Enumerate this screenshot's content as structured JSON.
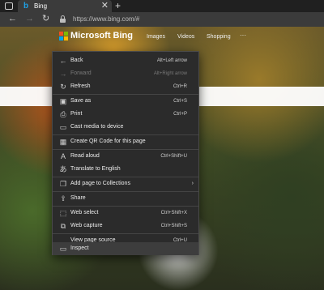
{
  "browser": {
    "tab": {
      "title": "Bing",
      "favicon": "b",
      "close": "✕"
    },
    "new_tab": "+",
    "nav": {
      "back": "←",
      "forward": "→",
      "refresh": "↻"
    },
    "address": {
      "url": "https://www.bing.com/#"
    }
  },
  "page": {
    "logo_text": "Microsoft Bing",
    "nav_items": [
      "Images",
      "Videos",
      "Shopping"
    ],
    "more": "···"
  },
  "context_menu": {
    "items": [
      {
        "icon": "back-arrow-icon",
        "glyph": "←",
        "label": "Back",
        "shortcut": "Alt+Left arrow",
        "enabled": true
      },
      {
        "icon": "forward-arrow-icon",
        "glyph": "→",
        "label": "Forward",
        "shortcut": "Alt+Right arrow",
        "enabled": false
      },
      {
        "icon": "refresh-icon",
        "glyph": "↻",
        "label": "Refresh",
        "shortcut": "Ctrl+R",
        "enabled": true
      },
      {
        "icon": "save-icon",
        "glyph": "▣",
        "label": "Save as",
        "shortcut": "Ctrl+S",
        "enabled": true
      },
      {
        "icon": "print-icon",
        "glyph": "⎙",
        "label": "Print",
        "shortcut": "Ctrl+P",
        "enabled": true
      },
      {
        "icon": "cast-icon",
        "glyph": "▭",
        "label": "Cast media to device",
        "shortcut": "",
        "enabled": true
      },
      {
        "icon": "qr-code-icon",
        "glyph": "▦",
        "label": "Create QR Code for this page",
        "shortcut": "",
        "enabled": true
      },
      {
        "icon": "read-aloud-icon",
        "glyph": "A",
        "label": "Read aloud",
        "shortcut": "Ctrl+Shift+U",
        "enabled": true
      },
      {
        "icon": "translate-icon",
        "glyph": "あ",
        "label": "Translate to English",
        "shortcut": "",
        "enabled": true
      },
      {
        "icon": "collections-icon",
        "glyph": "❐",
        "label": "Add page to Collections",
        "shortcut": "",
        "enabled": true,
        "submenu": "›"
      },
      {
        "icon": "share-icon",
        "glyph": "⇪",
        "label": "Share",
        "shortcut": "",
        "enabled": true
      },
      {
        "icon": "web-select-icon",
        "glyph": "⬚",
        "label": "Web select",
        "shortcut": "Ctrl+Shift+X",
        "enabled": true
      },
      {
        "icon": "web-capture-icon",
        "glyph": "⧉",
        "label": "Web capture",
        "shortcut": "Ctrl+Shift+S",
        "enabled": true
      },
      {
        "icon": "view-source-icon",
        "glyph": "",
        "label": "View page source",
        "shortcut": "Ctrl+U",
        "enabled": true
      },
      {
        "icon": "inspect-icon",
        "glyph": "▭",
        "label": "Inspect",
        "shortcut": "",
        "enabled": true,
        "highlighted": true
      }
    ]
  },
  "colors": {
    "menu_bg": "#2b2b2b",
    "menu_highlight": "#3d3d3d",
    "toolbar_bg": "#3b3b3b",
    "tab_strip_bg": "#202020"
  }
}
